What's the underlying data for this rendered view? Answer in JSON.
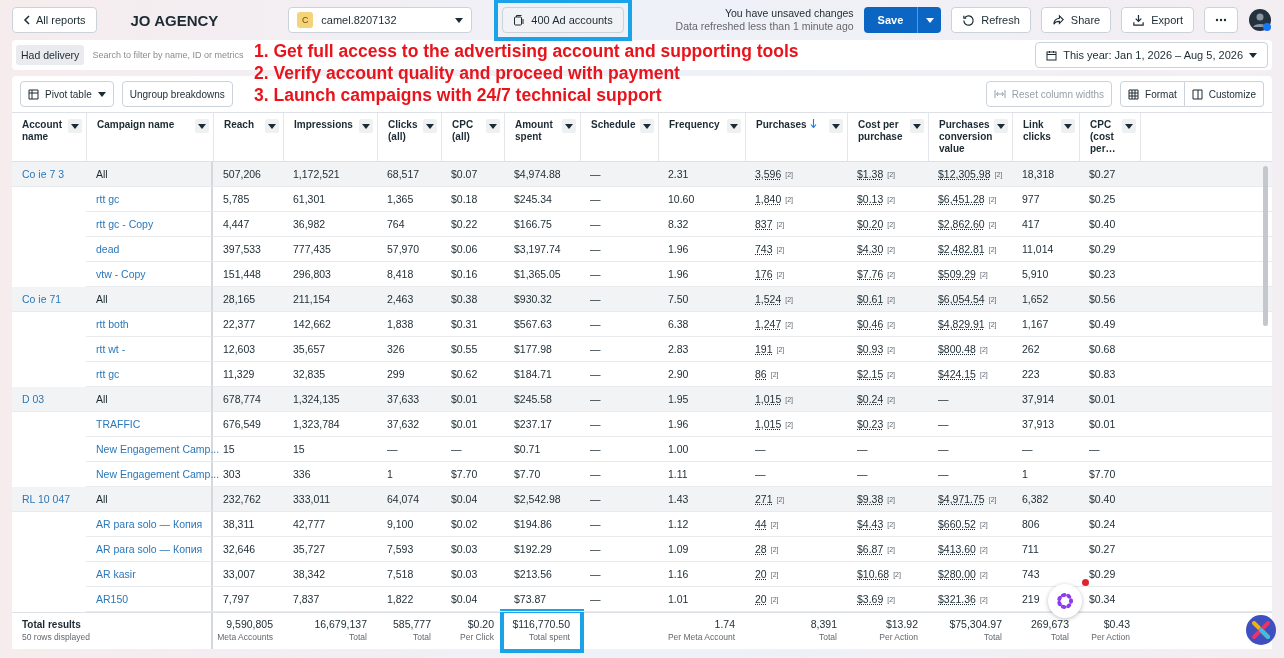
{
  "top_bar": {
    "back_button": "All reports",
    "title": "JO AGENCY",
    "account_select": {
      "avatar_letter": "C",
      "value": "camel.8207132"
    },
    "ad_accounts_button": {
      "label": "400 Ad accounts",
      "highlighted": true
    },
    "status": [
      "You have unsaved changes",
      "Data refreshed less than 1 minute ago"
    ],
    "save_button": "Save",
    "buttons": [
      "Refresh",
      "Share",
      "Export"
    ]
  },
  "filter_bar": {
    "chip": "Had delivery",
    "search": {
      "placeholder": "Search to filter by name, ID or metrics"
    },
    "date_range": "This year: Jan 1, 2026 – Aug 5, 2026"
  },
  "overlay_text": [
    "1. Get full access to the advertising account and supporting tools",
    "2. Verify account quality and proceed with payment",
    "3. Launch campaigns with 24/7 technical support"
  ],
  "toolbar": {
    "pivot": "Pivot table",
    "ungroup": "Ungroup breakdowns",
    "reset": {
      "label": "Reset column widths",
      "disabled": true
    },
    "format": "Format",
    "customize": "Customize"
  },
  "table": {
    "columns": [
      {
        "label": "Account name"
      },
      {
        "label": "Campaign name"
      },
      {
        "label": "Reach",
        "total": {
          "value": "9,590,805",
          "label": "Meta Accounts"
        }
      },
      {
        "label": "Impressions",
        "total": {
          "value": "16,679,137",
          "label": "Total"
        }
      },
      {
        "label": "Clicks (all)",
        "total": {
          "value": "585,777",
          "label": "Total"
        }
      },
      {
        "label": "CPC (all)",
        "total": {
          "value": "$0.20",
          "label": "Per Click"
        }
      },
      {
        "label": "Amount spent",
        "total": {
          "value": "$116,770.50",
          "label": "Total spent",
          "highlighted": true
        }
      },
      {
        "label": "Schedule"
      },
      {
        "label": "Frequency",
        "total": {
          "value": "1.74",
          "label": "Per Meta Account"
        }
      },
      {
        "label": "Purchases",
        "sorted": true,
        "total": {
          "value": "8,391",
          "label": "Total"
        }
      },
      {
        "label": "Cost per purchase",
        "total": {
          "value": "$13.92",
          "label": "Per Action"
        }
      },
      {
        "label": "Purchases conversion value",
        "total": {
          "value": "$75,304.97",
          "label": "Total"
        }
      },
      {
        "label": "Link clicks",
        "total": {
          "value": "269,673",
          "label": "Total"
        }
      },
      {
        "label": "CPC (cost per…",
        "total": {
          "value": "$0.43",
          "label": "Per Action"
        }
      }
    ],
    "groups": [
      {
        "account": "Co  ie 7  3",
        "rows": [
          {
            "kind": "summary",
            "campaign": "All",
            "cells": [
              "507,206",
              "1,172,521",
              "68,517",
              "$0.07",
              "$4,974.88",
              "—",
              "2.31",
              {
                "text": "3,596",
                "note": "[2]"
              },
              {
                "text": "$1.38",
                "note": "[2]"
              },
              {
                "text": "$12,305.98",
                "note": "[2]"
              },
              "18,318",
              "$0.27"
            ]
          },
          {
            "kind": "campaign",
            "campaign": "rtt gc",
            "cells": [
              "5,785",
              "61,301",
              "1,365",
              "$0.18",
              "$245.34",
              "—",
              "10.60",
              {
                "text": "1,840",
                "note": "[2]"
              },
              {
                "text": "$0.13",
                "note": "[2]"
              },
              {
                "text": "$6,451.28",
                "note": "[2]"
              },
              "977",
              "$0.25"
            ]
          },
          {
            "kind": "campaign",
            "campaign": "rtt gc - Copy",
            "cells": [
              "4,447",
              "36,982",
              "764",
              "$0.22",
              "$166.75",
              "—",
              "8.32",
              {
                "text": "837",
                "note": "[2]"
              },
              {
                "text": "$0.20",
                "note": "[2]"
              },
              {
                "text": "$2,862.60",
                "note": "[2]"
              },
              "417",
              "$0.40"
            ]
          },
          {
            "kind": "campaign",
            "campaign": "dead",
            "cells": [
              "397,533",
              "777,435",
              "57,970",
              "$0.06",
              "$3,197.74",
              "—",
              "1.96",
              {
                "text": "743",
                "note": "[2]"
              },
              {
                "text": "$4.30",
                "note": "[2]"
              },
              {
                "text": "$2,482.81",
                "note": "[2]"
              },
              "11,014",
              "$0.29"
            ]
          },
          {
            "kind": "campaign",
            "campaign": "vtw - Copy",
            "cells": [
              "151,448",
              "296,803",
              "8,418",
              "$0.16",
              "$1,365.05",
              "—",
              "1.96",
              {
                "text": "176",
                "note": "[2]"
              },
              {
                "text": "$7.76",
                "note": "[2]"
              },
              {
                "text": "$509.29",
                "note": "[2]"
              },
              "5,910",
              "$0.23"
            ]
          }
        ]
      },
      {
        "account": "Co  ie  71",
        "rows": [
          {
            "kind": "summary",
            "campaign": "All",
            "cells": [
              "28,165",
              "211,154",
              "2,463",
              "$0.38",
              "$930.32",
              "—",
              "7.50",
              {
                "text": "1,524",
                "note": "[2]"
              },
              {
                "text": "$0.61",
                "note": "[2]"
              },
              {
                "text": "$6,054.54",
                "note": "[2]"
              },
              "1,652",
              "$0.56"
            ]
          },
          {
            "kind": "campaign",
            "campaign": "rtt both",
            "cells": [
              "22,377",
              "142,662",
              "1,838",
              "$0.31",
              "$567.63",
              "—",
              "6.38",
              {
                "text": "1,247",
                "note": "[2]"
              },
              {
                "text": "$0.46",
                "note": "[2]"
              },
              {
                "text": "$4,829.91",
                "note": "[2]"
              },
              "1,167",
              "$0.49"
            ]
          },
          {
            "kind": "campaign",
            "campaign": "rtt wt -",
            "cells": [
              "12,603",
              "35,657",
              "326",
              "$0.55",
              "$177.98",
              "—",
              "2.83",
              {
                "text": "191",
                "note": "[2]"
              },
              {
                "text": "$0.93",
                "note": "[2]"
              },
              {
                "text": "$800.48",
                "note": "[2]"
              },
              "262",
              "$0.68"
            ]
          },
          {
            "kind": "campaign",
            "campaign": "rtt gc",
            "cells": [
              "11,329",
              "32,835",
              "299",
              "$0.62",
              "$184.71",
              "—",
              "2.90",
              {
                "text": "86",
                "note": "[2]"
              },
              {
                "text": "$2.15",
                "note": "[2]"
              },
              {
                "text": "$424.15",
                "note": "[2]"
              },
              "223",
              "$0.83"
            ]
          }
        ]
      },
      {
        "account": "D  03",
        "rows": [
          {
            "kind": "summary",
            "campaign": "All",
            "cells": [
              "678,774",
              "1,324,135",
              "37,633",
              "$0.01",
              "$245.58",
              "—",
              "1.95",
              {
                "text": "1,015",
                "note": "[2]"
              },
              {
                "text": "$0.24",
                "note": "[2]"
              },
              "—",
              "37,914",
              "$0.01"
            ]
          },
          {
            "kind": "campaign",
            "campaign": "TRAFFIC",
            "cells": [
              "676,549",
              "1,323,784",
              "37,632",
              "$0.01",
              "$237.17",
              "—",
              "1.96",
              {
                "text": "1,015",
                "note": "[2]"
              },
              {
                "text": "$0.23",
                "note": "[2]"
              },
              "—",
              "37,913",
              "$0.01"
            ]
          },
          {
            "kind": "campaign",
            "campaign": "New Engagement Camp...",
            "cells": [
              "15",
              "15",
              "—",
              "—",
              "$0.71",
              "—",
              "1.00",
              "—",
              "—",
              "—",
              "—",
              "—"
            ]
          },
          {
            "kind": "campaign",
            "campaign": "New Engagement Camp...",
            "cells": [
              "303",
              "336",
              "1",
              "$7.70",
              "$7.70",
              "—",
              "1.11",
              "—",
              "—",
              "—",
              "1",
              "$7.70"
            ]
          }
        ]
      },
      {
        "account": "RL 10  047",
        "rows": [
          {
            "kind": "summary",
            "campaign": "All",
            "cells": [
              "232,762",
              "333,011",
              "64,074",
              "$0.04",
              "$2,542.98",
              "—",
              "1.43",
              {
                "text": "271",
                "note": "[2]"
              },
              {
                "text": "$9.38",
                "note": "[2]"
              },
              {
                "text": "$4,971.75",
                "note": "[2]"
              },
              "6,382",
              "$0.40"
            ]
          },
          {
            "kind": "campaign",
            "campaign": "AR para solo — Копия",
            "cells": [
              "38,311",
              "42,777",
              "9,100",
              "$0.02",
              "$194.86",
              "—",
              "1.12",
              {
                "text": "44",
                "note": "[2]"
              },
              {
                "text": "$4.43",
                "note": "[2]"
              },
              {
                "text": "$660.52",
                "note": "[2]"
              },
              "806",
              "$0.24"
            ]
          },
          {
            "kind": "campaign",
            "campaign": "AR para solo — Копия",
            "cells": [
              "32,646",
              "35,727",
              "7,593",
              "$0.03",
              "$192.29",
              "—",
              "1.09",
              {
                "text": "28",
                "note": "[2]"
              },
              {
                "text": "$6.87",
                "note": "[2]"
              },
              {
                "text": "$413.60",
                "note": "[2]"
              },
              "711",
              "$0.27"
            ]
          },
          {
            "kind": "campaign",
            "campaign": "AR kasir",
            "cells": [
              "33,007",
              "38,342",
              "7,518",
              "$0.03",
              "$213.56",
              "—",
              "1.16",
              {
                "text": "20",
                "note": "[2]"
              },
              {
                "text": "$10.68",
                "note": "[2]"
              },
              {
                "text": "$280.00",
                "note": "[2]"
              },
              "743",
              "$0.29"
            ]
          },
          {
            "kind": "campaign",
            "campaign": "AR150",
            "cells": [
              "7,797",
              "7,837",
              "1,822",
              "$0.04",
              "$73.87",
              "—",
              "1.01",
              {
                "text": "20",
                "note": "[2]"
              },
              {
                "text": "$3.69",
                "note": "[2]"
              },
              {
                "text": "$321.36",
                "note": "[2]"
              },
              "219",
              "$0.34"
            ]
          }
        ]
      }
    ],
    "footer": {
      "title": "Total results",
      "subtitle": "50 rows displayed"
    }
  }
}
